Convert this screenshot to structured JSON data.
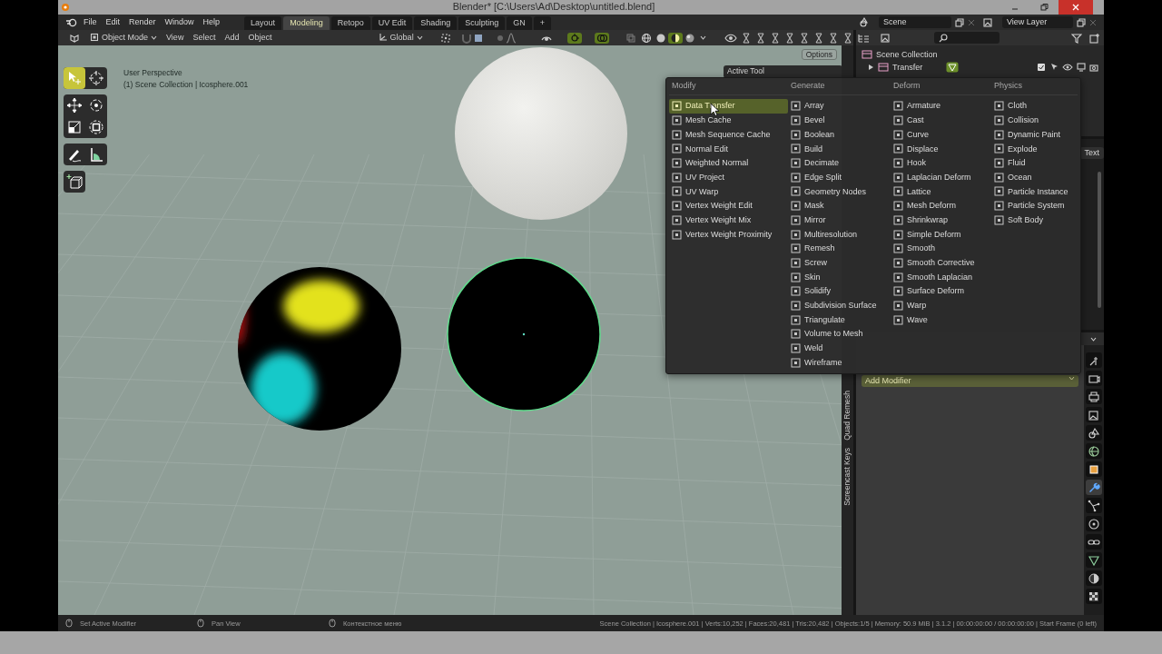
{
  "window": {
    "title": "Blender* [C:\\Users\\Ad\\Desktop\\untitled.blend]"
  },
  "menu_bar": {
    "items": [
      "File",
      "Edit",
      "Render",
      "Window",
      "Help"
    ]
  },
  "workspaces": [
    {
      "label": "Layout",
      "selected": false
    },
    {
      "label": "Modeling",
      "selected": true
    },
    {
      "label": "Retopo",
      "selected": false
    },
    {
      "label": "UV Edit",
      "selected": false
    },
    {
      "label": "Shading",
      "selected": false
    },
    {
      "label": "Sculpting",
      "selected": false
    },
    {
      "label": "GN",
      "selected": false
    }
  ],
  "add_workspace": "+",
  "scene_selector": {
    "scene": "Scene",
    "view_layer": "View Layer"
  },
  "viewport_header": {
    "mode": "Object Mode",
    "menus": [
      "View",
      "Select",
      "Add",
      "Object"
    ],
    "orientation": "Global",
    "toggles": [
      {
        "kind": "gizmo",
        "on": true
      },
      {
        "kind": "overlay",
        "on": true
      }
    ],
    "shading": [
      {
        "kind": "wireframe",
        "selected": false
      },
      {
        "kind": "solid",
        "selected": false
      },
      {
        "kind": "material",
        "selected": true
      },
      {
        "kind": "rendered",
        "selected": false
      }
    ]
  },
  "toolbar": {
    "groups": [
      {
        "tools": [
          {
            "kind": "select",
            "selected": true
          },
          {
            "kind": "cursor",
            "selected": false
          }
        ]
      },
      {
        "tools": [
          {
            "kind": "move",
            "selected": false
          },
          {
            "kind": "rotate",
            "selected": false
          },
          {
            "kind": "scale",
            "selected": false
          },
          {
            "kind": "transform",
            "selected": false
          }
        ]
      },
      {
        "tools": [
          {
            "kind": "annotate",
            "selected": false
          },
          {
            "kind": "measure",
            "selected": false
          }
        ]
      },
      {
        "tools": [
          {
            "kind": "add_cube",
            "selected": false
          }
        ]
      }
    ]
  },
  "viewport": {
    "perspective": "User Perspective",
    "collection": "(1) Scene Collection | Icosphere.001",
    "options": "Options",
    "active_tool": "Active Tool",
    "side_tabs": [
      "Quad Remesh",
      "Screencast Keys"
    ]
  },
  "outliner": {
    "root": "Scene Collection",
    "children": [
      {
        "label": "Transfer",
        "expanded": false
      }
    ]
  },
  "text_editor": {
    "text": "Text"
  },
  "modifier_menu": {
    "columns": [
      {
        "heading": "Modify",
        "items": [
          {
            "label": "Data Transfer",
            "selected": true
          },
          {
            "label": "Mesh Cache",
            "selected": false
          },
          {
            "label": "Mesh Sequence Cache",
            "selected": false
          },
          {
            "label": "Normal Edit",
            "selected": false
          },
          {
            "label": "Weighted Normal",
            "selected": false
          },
          {
            "label": "UV Project",
            "selected": false
          },
          {
            "label": "UV Warp",
            "selected": false
          },
          {
            "label": "Vertex Weight Edit",
            "selected": false
          },
          {
            "label": "Vertex Weight Mix",
            "selected": false
          },
          {
            "label": "Vertex Weight Proximity",
            "selected": false
          }
        ]
      },
      {
        "heading": "Generate",
        "items": [
          {
            "label": "Array",
            "selected": false
          },
          {
            "label": "Bevel",
            "selected": false
          },
          {
            "label": "Boolean",
            "selected": false
          },
          {
            "label": "Build",
            "selected": false
          },
          {
            "label": "Decimate",
            "selected": false
          },
          {
            "label": "Edge Split",
            "selected": false
          },
          {
            "label": "Geometry Nodes",
            "selected": false
          },
          {
            "label": "Mask",
            "selected": false
          },
          {
            "label": "Mirror",
            "selected": false
          },
          {
            "label": "Multiresolution",
            "selected": false
          },
          {
            "label": "Remesh",
            "selected": false
          },
          {
            "label": "Screw",
            "selected": false
          },
          {
            "label": "Skin",
            "selected": false
          },
          {
            "label": "Solidify",
            "selected": false
          },
          {
            "label": "Subdivision Surface",
            "selected": false
          },
          {
            "label": "Triangulate",
            "selected": false
          },
          {
            "label": "Volume to Mesh",
            "selected": false
          },
          {
            "label": "Weld",
            "selected": false
          },
          {
            "label": "Wireframe",
            "selected": false
          }
        ]
      },
      {
        "heading": "Deform",
        "items": [
          {
            "label": "Armature",
            "selected": false
          },
          {
            "label": "Cast",
            "selected": false
          },
          {
            "label": "Curve",
            "selected": false
          },
          {
            "label": "Displace",
            "selected": false
          },
          {
            "label": "Hook",
            "selected": false
          },
          {
            "label": "Laplacian Deform",
            "selected": false
          },
          {
            "label": "Lattice",
            "selected": false
          },
          {
            "label": "Mesh Deform",
            "selected": false
          },
          {
            "label": "Shrinkwrap",
            "selected": false
          },
          {
            "label": "Simple Deform",
            "selected": false
          },
          {
            "label": "Smooth",
            "selected": false
          },
          {
            "label": "Smooth Corrective",
            "selected": false
          },
          {
            "label": "Smooth Laplacian",
            "selected": false
          },
          {
            "label": "Surface Deform",
            "selected": false
          },
          {
            "label": "Warp",
            "selected": false
          },
          {
            "label": "Wave",
            "selected": false
          }
        ]
      },
      {
        "heading": "Physics",
        "items": [
          {
            "label": "Cloth",
            "selected": false
          },
          {
            "label": "Collision",
            "selected": false
          },
          {
            "label": "Dynamic Paint",
            "selected": false
          },
          {
            "label": "Explode",
            "selected": false
          },
          {
            "label": "Fluid",
            "selected": false
          },
          {
            "label": "Ocean",
            "selected": false
          },
          {
            "label": "Particle Instance",
            "selected": false
          },
          {
            "label": "Particle System",
            "selected": false
          },
          {
            "label": "Soft Body",
            "selected": false
          }
        ]
      }
    ]
  },
  "properties": {
    "add_modifier": "Add Modifier",
    "tabs": [
      {
        "kind": "tool",
        "selected": false
      },
      {
        "kind": "render",
        "selected": false
      },
      {
        "kind": "output",
        "selected": false
      },
      {
        "kind": "view_layer",
        "selected": false
      },
      {
        "kind": "scene",
        "selected": false
      },
      {
        "kind": "world",
        "selected": false
      },
      {
        "kind": "object",
        "selected": false
      },
      {
        "kind": "modifier",
        "selected": true
      },
      {
        "kind": "particles",
        "selected": false
      },
      {
        "kind": "physics",
        "selected": false
      },
      {
        "kind": "constraints",
        "selected": false
      },
      {
        "kind": "data",
        "selected": false
      },
      {
        "kind": "material",
        "selected": false
      },
      {
        "kind": "texture",
        "selected": false
      }
    ]
  },
  "status_bar": {
    "hints": [
      "Set Active Modifier",
      "Pan View",
      "Контекстное меню"
    ],
    "stats": "Scene Collection | Icosphere.001 | Verts:10,252 | Faces:20,481 | Tris:20,482 | Objects:1/5 | Memory: 50.9 MiB | 3.1.2 | 00:00:00:00 / 00:00:00:00 | Start Frame (0 left)"
  }
}
